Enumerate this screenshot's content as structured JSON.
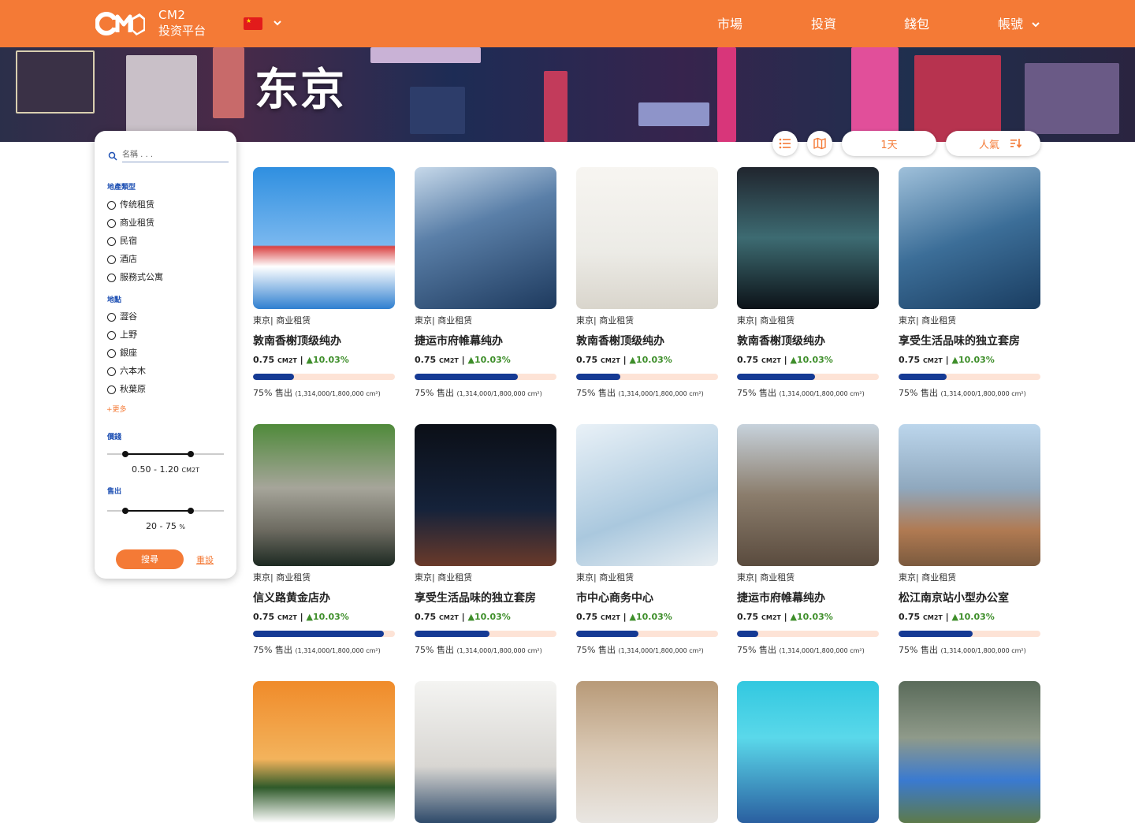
{
  "brand": {
    "line1": "CM2",
    "line2": "投资平台"
  },
  "nav": [
    {
      "label": "市場"
    },
    {
      "label": "投資"
    },
    {
      "label": "錢包"
    },
    {
      "label": "帳號"
    }
  ],
  "hero": {
    "title": "东京"
  },
  "filter": {
    "search_placeholder": "名稱 . . .",
    "type_title": "地產類型",
    "types": [
      "传统租赁",
      "商业租赁",
      "民宿",
      "酒店",
      "服務式公寓"
    ],
    "location_title": "地點",
    "locations": [
      "澀谷",
      "上野",
      "銀座",
      "六本木",
      "秋葉原"
    ],
    "more_label": "+更多",
    "price_title": "價錢",
    "price_range": "0.50 - 1.20",
    "price_unit": "CM2T",
    "price_min": 0.5,
    "price_max": 1.2,
    "sold_title": "售出",
    "sold_range": "20 - 75",
    "sold_unit": "%",
    "sold_min": 20,
    "sold_max": 75,
    "search_button": "搜尋",
    "reset_button": "重設"
  },
  "toolbar": {
    "period": "1天",
    "sort": "人氣"
  },
  "colors": {
    "accent": "#f47a36",
    "progress": "#153a94",
    "progress_track": "#fde3d6",
    "positive": "#3e8e2a"
  },
  "listings": [
    {
      "location": "東京| 商业租赁",
      "name": "敦南香榭顶级纯办",
      "price": "0.75",
      "unit": "CM2T",
      "change": "▲10.03%",
      "sold": "75%",
      "sold_label": "售出",
      "sold_detail": "(1,314,000/1,800,000 cm²)",
      "progress": 0.29
    },
    {
      "location": "東京| 商业租赁",
      "name": "捷运市府帷幕纯办",
      "price": "0.75",
      "unit": "CM2T",
      "change": "▲10.03%",
      "sold": "75%",
      "sold_label": "售出",
      "sold_detail": "(1,314,000/1,800,000 cm²)",
      "progress": 0.73
    },
    {
      "location": "東京| 商业租赁",
      "name": "敦南香榭顶级纯办",
      "price": "0.75",
      "unit": "CM2T",
      "change": "▲10.03%",
      "sold": "75%",
      "sold_label": "售出",
      "sold_detail": "(1,314,000/1,800,000 cm²)",
      "progress": 0.31
    },
    {
      "location": "東京| 商业租赁",
      "name": "敦南香榭顶级纯办",
      "price": "0.75",
      "unit": "CM2T",
      "change": "▲10.03%",
      "sold": "75%",
      "sold_label": "售出",
      "sold_detail": "(1,314,000/1,800,000 cm²)",
      "progress": 0.55
    },
    {
      "location": "東京| 商业租赁",
      "name": "享受生活品味的独立套房",
      "price": "0.75",
      "unit": "CM2T",
      "change": "▲10.03%",
      "sold": "75%",
      "sold_label": "售出",
      "sold_detail": "(1,314,000/1,800,000 cm²)",
      "progress": 0.34
    },
    {
      "location": "東京| 商业租赁",
      "name": "信义路黄金店办",
      "price": "0.75",
      "unit": "CM2T",
      "change": "▲10.03%",
      "sold": "75%",
      "sold_label": "售出",
      "sold_detail": "(1,314,000/1,800,000 cm²)",
      "progress": 0.92
    },
    {
      "location": "東京| 商业租赁",
      "name": "享受生活品味的独立套房",
      "price": "0.75",
      "unit": "CM2T",
      "change": "▲10.03%",
      "sold": "75%",
      "sold_label": "售出",
      "sold_detail": "(1,314,000/1,800,000 cm²)",
      "progress": 0.53
    },
    {
      "location": "東京| 商业租赁",
      "name": "市中心商务中心",
      "price": "0.75",
      "unit": "CM2T",
      "change": "▲10.03%",
      "sold": "75%",
      "sold_label": "售出",
      "sold_detail": "(1,314,000/1,800,000 cm²)",
      "progress": 0.44
    },
    {
      "location": "東京| 商业租赁",
      "name": "捷运市府帷幕纯办",
      "price": "0.75",
      "unit": "CM2T",
      "change": "▲10.03%",
      "sold": "75%",
      "sold_label": "售出",
      "sold_detail": "(1,314,000/1,800,000 cm²)",
      "progress": 0.15
    },
    {
      "location": "東京| 商业租赁",
      "name": "松江南京站小型办公室",
      "price": "0.75",
      "unit": "CM2T",
      "change": "▲10.03%",
      "sold": "75%",
      "sold_label": "售出",
      "sold_detail": "(1,314,000/1,800,000 cm²)",
      "progress": 0.52
    },
    {
      "location": "",
      "name": "",
      "price": "",
      "unit": "",
      "change": "",
      "sold": "",
      "sold_label": "",
      "sold_detail": "",
      "progress": 0
    },
    {
      "location": "",
      "name": "",
      "price": "",
      "unit": "",
      "change": "",
      "sold": "",
      "sold_label": "",
      "sold_detail": "",
      "progress": 0
    },
    {
      "location": "",
      "name": "",
      "price": "",
      "unit": "",
      "change": "",
      "sold": "",
      "sold_label": "",
      "sold_detail": "",
      "progress": 0
    },
    {
      "location": "",
      "name": "",
      "price": "",
      "unit": "",
      "change": "",
      "sold": "",
      "sold_label": "",
      "sold_detail": "",
      "progress": 0
    },
    {
      "location": "",
      "name": "",
      "price": "",
      "unit": "",
      "change": "",
      "sold": "",
      "sold_label": "",
      "sold_detail": "",
      "progress": 0
    }
  ]
}
